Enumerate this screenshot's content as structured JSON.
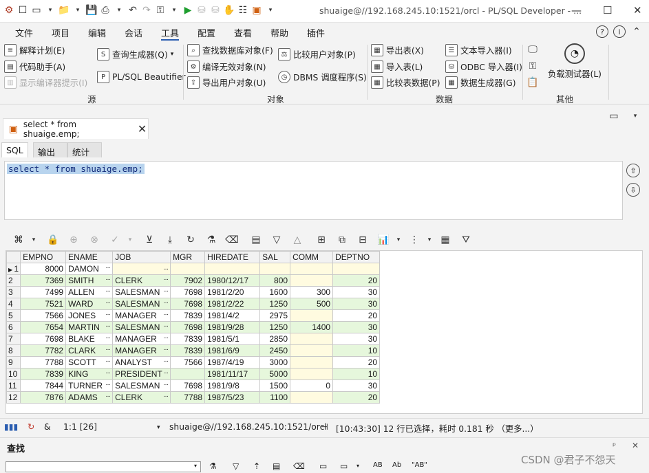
{
  "titlebar": {
    "title": "shuaige@//192.168.245.10:1521/orcl - PL/SQL Developer - ...",
    "minimize": "—",
    "maximize": "☐",
    "close": "✕"
  },
  "menu": [
    "文件",
    "项目",
    "编辑",
    "会话",
    "工具",
    "配置",
    "查看",
    "帮助",
    "插件"
  ],
  "ribbon": {
    "source": {
      "items": [
        "解释计划(E)",
        "代码助手(A)",
        "显示编译器提示(I)",
        "查询生成器(Q)",
        "PL/SQL Beautifier"
      ],
      "group": "源"
    },
    "objects": {
      "items": [
        "查找数据库对象(F)",
        "编译无效对象(N)",
        "导出用户对象(U)",
        "比较用户对象(P)",
        "DBMS 调度程序(S)"
      ],
      "group": "对象"
    },
    "data": {
      "items": [
        "导出表(X)",
        "导入表(L)",
        "比较表数据(P)",
        "文本导入器(I)",
        "ODBC 导入器(I)",
        "数据生成器(G)"
      ],
      "group": "数据"
    },
    "other": {
      "items": [
        "负载测试器(L)"
      ],
      "group": "其他"
    }
  },
  "tab": {
    "label": "select * from shuaige.emp;"
  },
  "subtabs": [
    "SQL",
    "输出",
    "统计"
  ],
  "editor": {
    "code": "select * from shuaige.emp;"
  },
  "grid": {
    "columns": [
      "EMPNO",
      "ENAME",
      "JOB",
      "MGR",
      "HIREDATE",
      "SAL",
      "COMM",
      "DEPTNO"
    ],
    "rows": [
      [
        "1",
        "8000",
        "DAMON",
        "",
        "",
        "",
        "",
        "",
        ""
      ],
      [
        "2",
        "7369",
        "SMITH",
        "CLERK",
        "7902",
        "1980/12/17",
        "800",
        "",
        "20"
      ],
      [
        "3",
        "7499",
        "ALLEN",
        "SALESMAN",
        "7698",
        "1981/2/20",
        "1600",
        "300",
        "30"
      ],
      [
        "4",
        "7521",
        "WARD",
        "SALESMAN",
        "7698",
        "1981/2/22",
        "1250",
        "500",
        "30"
      ],
      [
        "5",
        "7566",
        "JONES",
        "MANAGER",
        "7839",
        "1981/4/2",
        "2975",
        "",
        "20"
      ],
      [
        "6",
        "7654",
        "MARTIN",
        "SALESMAN",
        "7698",
        "1981/9/28",
        "1250",
        "1400",
        "30"
      ],
      [
        "7",
        "7698",
        "BLAKE",
        "MANAGER",
        "7839",
        "1981/5/1",
        "2850",
        "",
        "30"
      ],
      [
        "8",
        "7782",
        "CLARK",
        "MANAGER",
        "7839",
        "1981/6/9",
        "2450",
        "",
        "10"
      ],
      [
        "9",
        "7788",
        "SCOTT",
        "ANALYST",
        "7566",
        "1987/4/19",
        "3000",
        "",
        "20"
      ],
      [
        "10",
        "7839",
        "KING",
        "PRESIDENT",
        "",
        "1981/11/17",
        "5000",
        "",
        "10"
      ],
      [
        "11",
        "7844",
        "TURNER",
        "SALESMAN",
        "7698",
        "1981/9/8",
        "1500",
        "0",
        "30"
      ],
      [
        "12",
        "7876",
        "ADAMS",
        "CLERK",
        "7788",
        "1987/5/23",
        "1100",
        "",
        "20"
      ]
    ]
  },
  "status": {
    "position": "1:1 [26]",
    "connection": "shuaige@//192.168.245.10:1521/orcl",
    "message": "[10:43:30]  12 行已选择，耗时 0.181 秒 （更多...）"
  },
  "find": {
    "label": "查找",
    "pin": "ᵖ",
    "close": "✕"
  },
  "watermark": "CSDN @君子不怨天"
}
